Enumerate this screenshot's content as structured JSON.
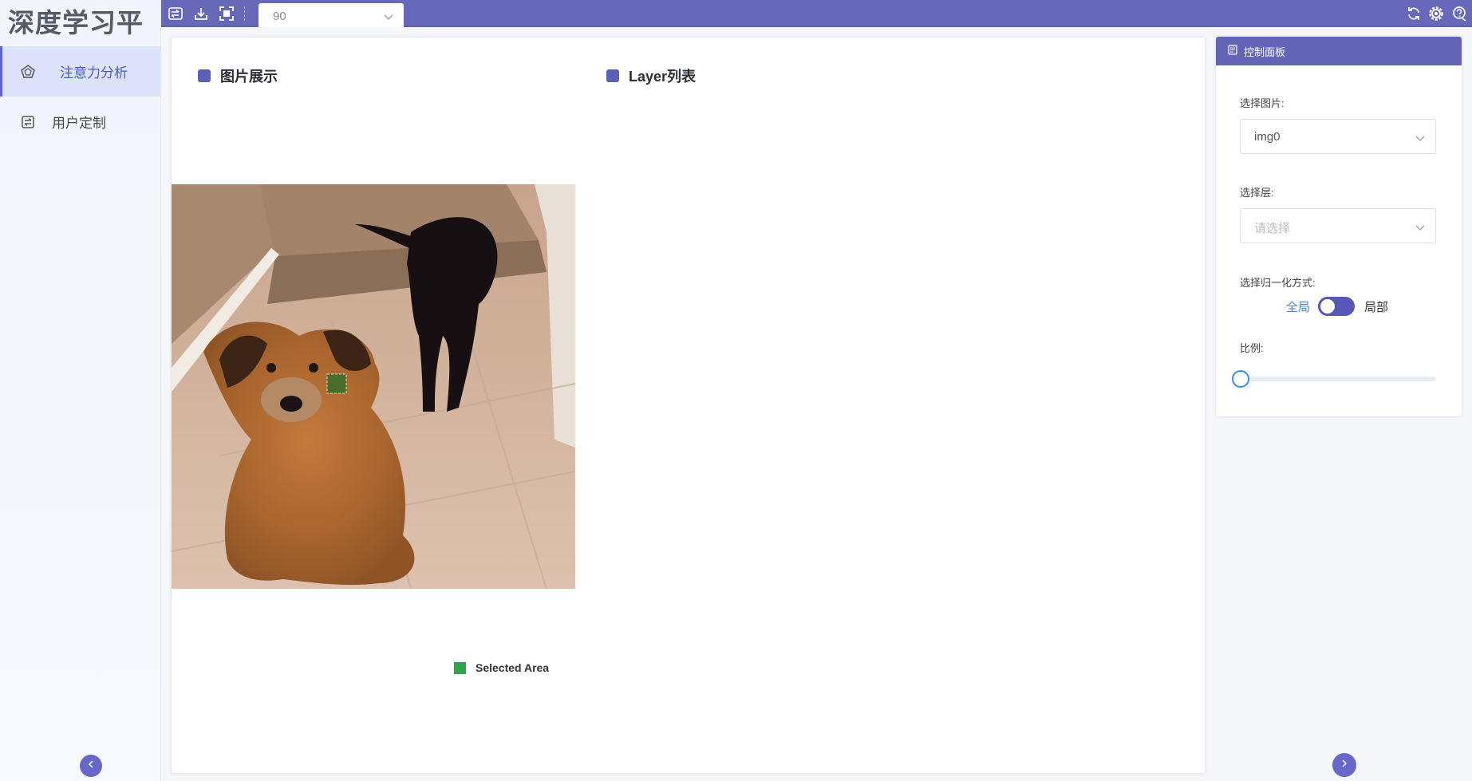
{
  "app": {
    "title": "深度学习平台"
  },
  "sidebar": {
    "items": [
      {
        "label": "注意力分析",
        "icon": "pentagon-icon",
        "active": true
      },
      {
        "label": "用户定制",
        "icon": "transfer-icon",
        "active": false
      }
    ],
    "collapse_icon": "chevron-left-icon"
  },
  "topbar": {
    "select_value": "90",
    "left_icons": [
      "import-icon",
      "download-icon",
      "fullscreen-icon"
    ],
    "right_icons": [
      "refresh-icon",
      "settings-icon",
      "help-icon"
    ]
  },
  "main": {
    "image_section_title": "图片展示",
    "layer_section_title": "Layer列表",
    "legend_label": "Selected Area"
  },
  "panel": {
    "title": "控制面板",
    "select_image_label": "选择图片:",
    "select_image_value": "img0",
    "select_layer_label": "选择层:",
    "select_layer_placeholder": "请选择",
    "normalize_label": "选择归一化方式:",
    "normalize_option_left": "全局",
    "normalize_option_right": "局部",
    "ratio_label": "比例:",
    "ratio_value": 0
  },
  "colors": {
    "accent": "#6868bb",
    "selected_area": "#2fa350",
    "link_blue": "#3f86d8"
  }
}
